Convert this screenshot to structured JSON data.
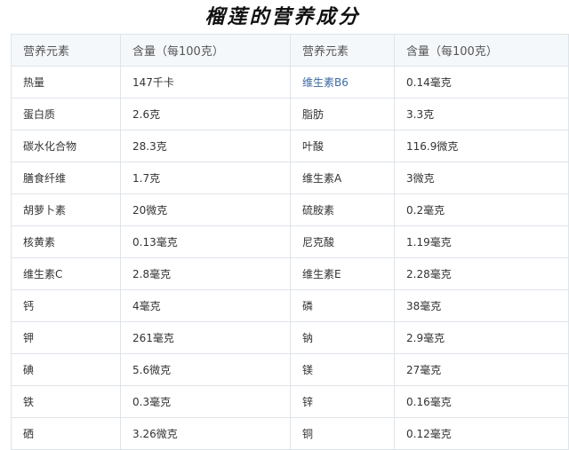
{
  "title": "榴莲的营养成分",
  "table": {
    "headers": [
      "营养元素",
      "含量（每100克）",
      "营养元素",
      "含量（每100克）"
    ],
    "rows": [
      [
        "热量",
        "147千卡",
        "维生素B6",
        "0.14毫克"
      ],
      [
        "蛋白质",
        "2.6克",
        "脂肪",
        "3.3克"
      ],
      [
        "碳水化合物",
        "28.3克",
        "叶酸",
        "116.9微克"
      ],
      [
        "膳食纤维",
        "1.7克",
        "维生素A",
        "3微克"
      ],
      [
        "胡萝卜素",
        "20微克",
        "硫胺素",
        "0.2毫克"
      ],
      [
        "核黄素",
        "0.13毫克",
        "尼克酸",
        "1.19毫克"
      ],
      [
        "维生素C",
        "2.8毫克",
        "维生素E",
        "2.28毫克"
      ],
      [
        "钙",
        "4毫克",
        "磷",
        "38毫克"
      ],
      [
        "钾",
        "261毫克",
        "钠",
        "2.9毫克"
      ],
      [
        "碘",
        "5.6微克",
        "镁",
        "27毫克"
      ],
      [
        "铁",
        "0.3毫克",
        "锌",
        "0.16毫克"
      ],
      [
        "硒",
        "3.26微克",
        "铜",
        "0.12毫克"
      ]
    ]
  },
  "colors": {
    "link": "#3b6aa5",
    "header_bg": "#f5f8fb",
    "border": "#dfe4ea"
  }
}
